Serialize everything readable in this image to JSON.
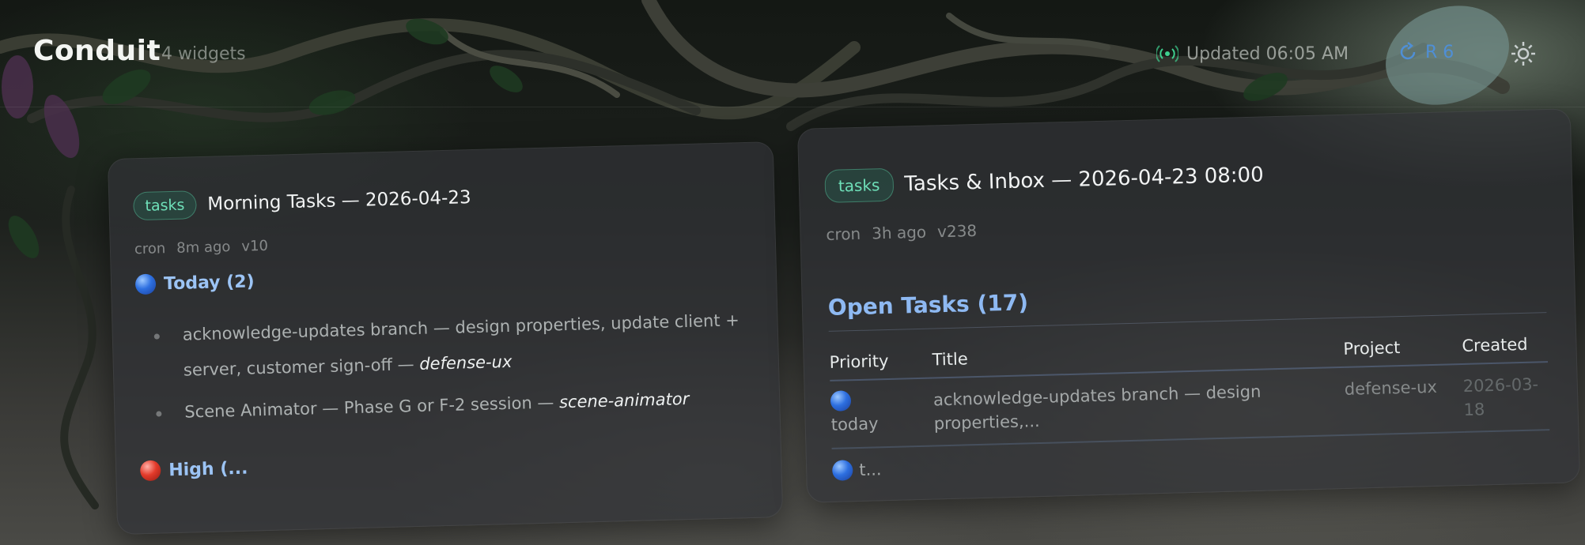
{
  "app": {
    "title": "Conduit",
    "widget_count": "4 widgets"
  },
  "status": {
    "updated_text": "Updated 06:05 AM",
    "refresh_label": "R 6"
  },
  "icons": {
    "live": "broadcast-icon",
    "refresh": "refresh-icon",
    "settings": "gear-icon"
  },
  "colors": {
    "accent_green": "#6fe0b9",
    "accent_blue": "#8eb9f2",
    "link_blue": "#4f8fd6"
  },
  "cards": [
    {
      "tag": "tasks",
      "title": "Morning Tasks — 2026-04-23",
      "meta": {
        "source": "cron",
        "age": "8m ago",
        "version": "v10"
      },
      "sections": [
        {
          "icon": "blue-circle",
          "label": "Today (2)",
          "items": [
            {
              "text": "acknowledge-updates branch — design properties, update client + server, customer sign-off — ",
              "project": "defense-ux"
            },
            {
              "text": "Scene Animator — Phase G or F-2 session — ",
              "project": "scene-animator"
            }
          ]
        },
        {
          "icon": "red-circle",
          "label": "High (..."
        }
      ]
    },
    {
      "tag": "tasks",
      "title": "Tasks & Inbox — 2026-04-23 08:00",
      "meta": {
        "source": "cron",
        "age": "3h ago",
        "version": "v238"
      },
      "heading": "Open Tasks (17)",
      "table": {
        "columns": [
          "Priority",
          "Title",
          "Project",
          "Created"
        ],
        "rows": [
          {
            "priority": "today",
            "title": "acknowledge-updates branch — design properties,...",
            "project": "defense-ux",
            "created": "2026-03-18"
          },
          {
            "priority": "t..."
          }
        ]
      }
    }
  ]
}
